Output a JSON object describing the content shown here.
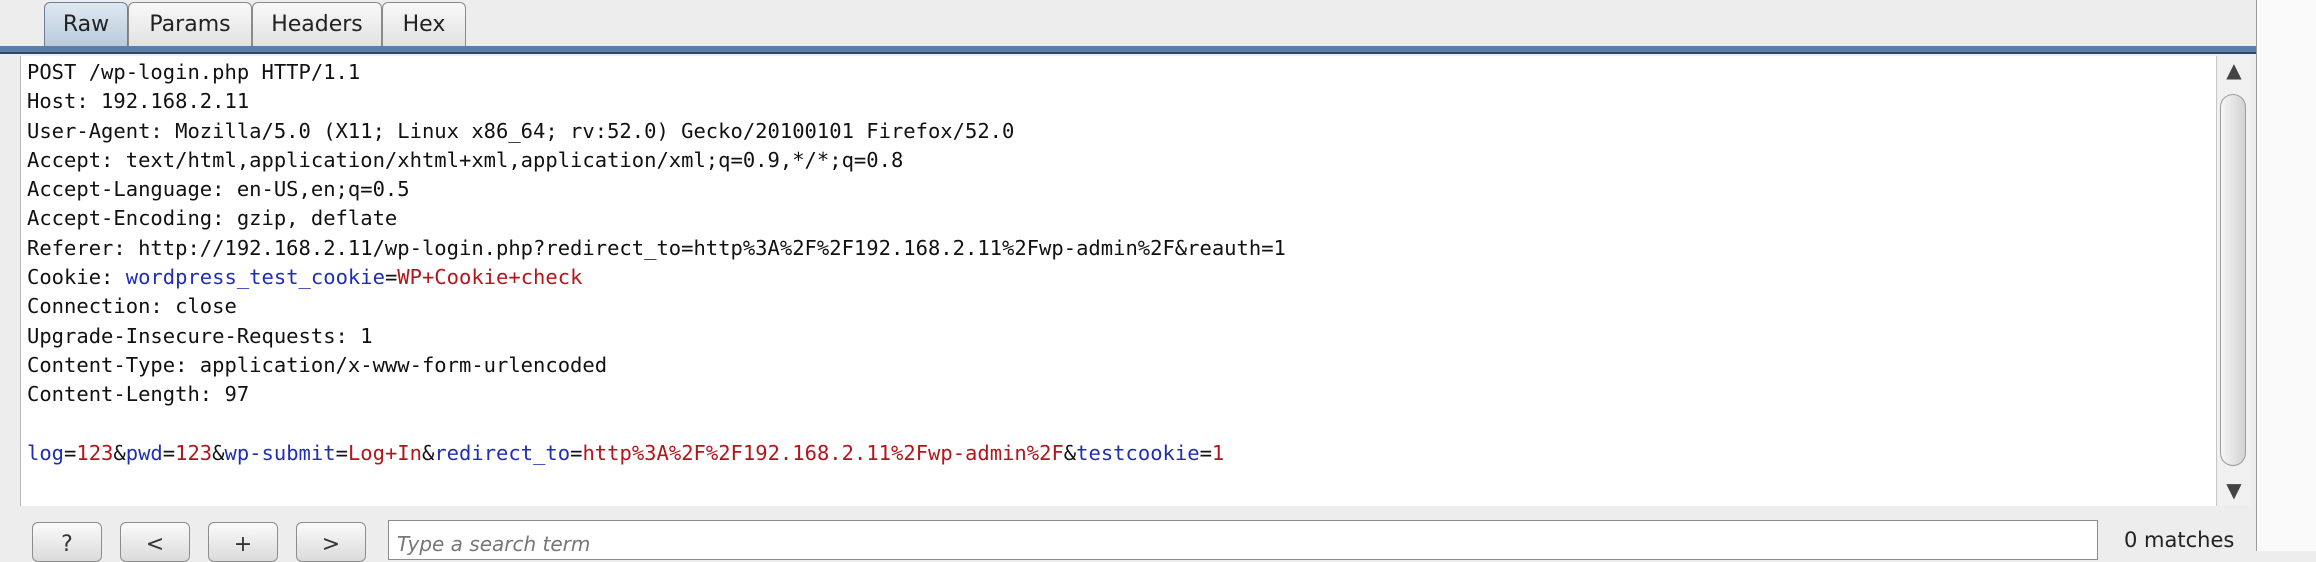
{
  "tabs": [
    {
      "label": "Raw",
      "active": true
    },
    {
      "label": "Params",
      "active": false
    },
    {
      "label": "Headers",
      "active": false
    },
    {
      "label": "Hex",
      "active": false
    }
  ],
  "request": {
    "lines": [
      "POST /wp-login.php HTTP/1.1",
      "Host: 192.168.2.11",
      "User-Agent: Mozilla/5.0 (X11; Linux x86_64; rv:52.0) Gecko/20100101 Firefox/52.0",
      "Accept: text/html,application/xhtml+xml,application/xml;q=0.9,*/*;q=0.8",
      "Accept-Language: en-US,en;q=0.5",
      "Accept-Encoding: gzip, deflate",
      "Referer: http://192.168.2.11/wp-login.php?redirect_to=http%3A%2F%2F192.168.2.11%2Fwp-admin%2F&reauth=1"
    ],
    "cookie": {
      "prefix": "Cookie: ",
      "name": "wordpress_test_cookie",
      "eq": "=",
      "value": "WP+Cookie+check"
    },
    "lines_after_cookie": [
      "Connection: close",
      "Upgrade-Insecure-Requests: 1",
      "Content-Type: application/x-www-form-urlencoded",
      "Content-Length: 97"
    ],
    "body_params": [
      {
        "key": "log",
        "value": "123"
      },
      {
        "key": "pwd",
        "value": "123"
      },
      {
        "key": "wp-submit",
        "value": "Log+In"
      },
      {
        "key": "redirect_to",
        "value": "http%3A%2F%2F192.168.2.11%2Fwp-admin%2F"
      },
      {
        "key": "testcookie",
        "value": "1"
      }
    ]
  },
  "search": {
    "buttons": {
      "help": "?",
      "prev": "<",
      "add": "+",
      "next": ">"
    },
    "placeholder": "Type a search term",
    "value": "",
    "matches": "0 matches"
  },
  "scrollbar": {
    "up_glyph": "▲",
    "down_glyph": "▼"
  },
  "colors": {
    "param_name": "#1f2fb4",
    "param_value": "#b3151b",
    "tab_accent": "#5b7fa6"
  }
}
